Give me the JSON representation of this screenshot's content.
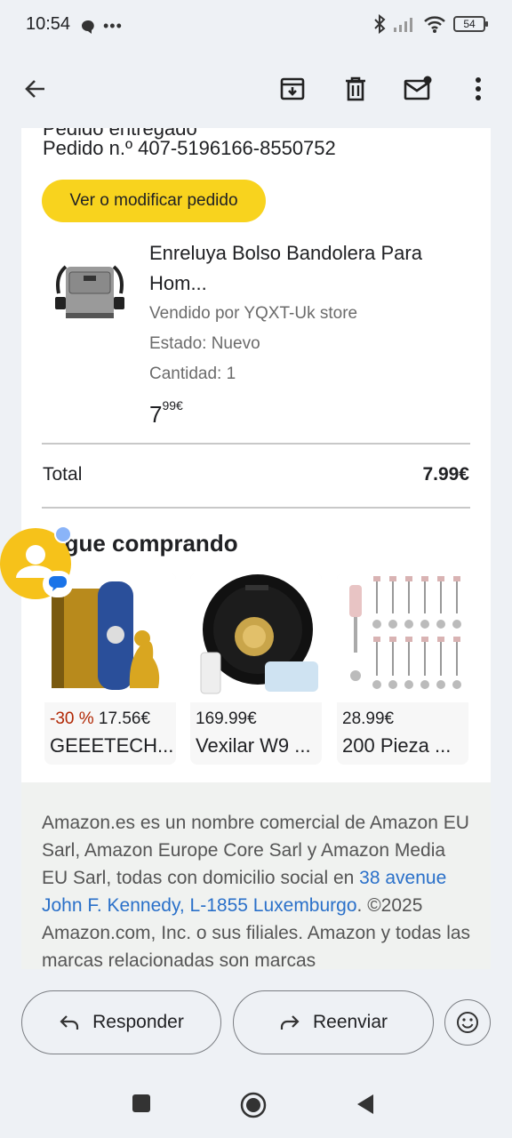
{
  "status": {
    "time": "10:54",
    "battery": "54"
  },
  "order": {
    "number_line": "Pedido n.º 407-5196166-8550752",
    "cut_line": "Pedido entregado",
    "button_label": "Ver o modificar pedido"
  },
  "product": {
    "title": "Enreluya Bolso Bandolera Para Hom...",
    "seller": "Vendido por YQXT-Uk store",
    "condition": "Estado: Nuevo",
    "quantity": "Cantidad: 1",
    "price_whole": "7",
    "price_fraction": "99€"
  },
  "total": {
    "label": "Total",
    "value": "7.99€"
  },
  "section": {
    "title": "Sigue comprando"
  },
  "recommendations": [
    {
      "discount": "-30 %",
      "price": "17.56€",
      "name": "GEEETECH..."
    },
    {
      "discount": "",
      "price": "169.99€",
      "name": "Vexilar W9 ..."
    },
    {
      "discount": "",
      "price": "28.99€",
      "name": "200 Pieza ..."
    }
  ],
  "footer": {
    "text_1": "Amazon.es es un nombre comercial de Amazon EU Sarl, Amazon Europe Core Sarl y Amazon Media EU Sarl, todas con domicilio social en ",
    "link": "38 avenue John F. Kennedy, L-1855 Luxemburgo",
    "text_2": ". ©2025 Amazon.com, Inc. o sus filiales. Amazon y todas las marcas relacionadas son marcas"
  },
  "actions": {
    "reply": "Responder",
    "forward": "Reenviar"
  },
  "colors": {
    "accent_yellow": "#f8d31e",
    "link_blue": "#2a70c9",
    "discount_red": "#b12704"
  }
}
